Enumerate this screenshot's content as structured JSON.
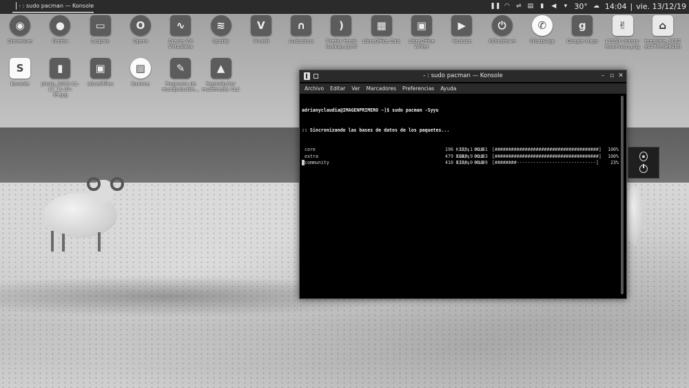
{
  "panel": {
    "task_title": "- : sudo pacman — Konsole",
    "tray": {
      "temperature": "30°",
      "clock": "14:04",
      "separator": "|",
      "date": "vie. 13/12/19",
      "icons": [
        "pause-icon",
        "wifi-icon",
        "usb-icon",
        "clipboard-icon",
        "battery-icon",
        "volume-icon",
        "expand-icon",
        "weather-cloud-icon"
      ]
    }
  },
  "desktop_icons": [
    {
      "label": "Chromium",
      "glyph": "◉",
      "icon": "chromium-icon"
    },
    {
      "label": "Firefox",
      "glyph": "●",
      "icon": "firefox-icon"
    },
    {
      "label": "Dolphin",
      "glyph": "▭",
      "icon": "folder-icon"
    },
    {
      "label": "Opera",
      "glyph": "O",
      "icon": "opera-icon"
    },
    {
      "label": "Oracle VM VirtualBox",
      "glyph": "∿",
      "icon": "virtualbox-icon"
    },
    {
      "label": "Spotify",
      "glyph": "≋",
      "icon": "spotify-icon"
    },
    {
      "label": "Vivaldi",
      "glyph": "V",
      "icon": "vivaldi-icon"
    },
    {
      "label": "Audacious",
      "glyph": "∩",
      "icon": "headphones-icon"
    },
    {
      "label": "Firefox feeds backup.opml",
      "glyph": ")",
      "icon": "rss-file-icon"
    },
    {
      "label": "LibreOffice Calc",
      "glyph": "▦",
      "icon": "calc-icon"
    },
    {
      "label": "LibreOffice Writer",
      "glyph": "▣",
      "icon": "writer-icon"
    },
    {
      "label": "Youtube",
      "glyph": "▶",
      "icon": "youtube-icon"
    },
    {
      "label": "XShutdown",
      "glyph": "⏻",
      "icon": "shutdown-icon"
    },
    {
      "label": "WhatsApp",
      "glyph": "✆",
      "icon": "whatsapp-icon"
    },
    {
      "label": "Google Maps",
      "glyph": "g",
      "icon": "google-maps-icon"
    },
    {
      "label": "11559-victory-hand-icon.png",
      "glyph": "✌",
      "icon": "victory-hand-icon"
    },
    {
      "label": "template_9682e2278ede82bb",
      "glyph": "⌂",
      "icon": "pdf-file-icon"
    },
    {
      "label": "Konsole",
      "glyph": "S",
      "icon": "konsole-icon"
    },
    {
      "label": "photo_2019-11-17_11-24-39.jpg",
      "glyph": "▮",
      "icon": "image-file-icon"
    },
    {
      "label": "LibreOffice",
      "glyph": "▣",
      "icon": "libreoffice-icon"
    },
    {
      "label": "Ramme",
      "glyph": "▨",
      "icon": "ramme-icon"
    },
    {
      "label": "Programa de manipulación...",
      "glyph": "✎",
      "icon": "gimp-icon"
    },
    {
      "label": "Reproductor multimedia VLC",
      "glyph": "▲",
      "icon": "vlc-icon"
    }
  ],
  "konsole": {
    "title": "- : sudo pacman — Konsole",
    "menu": [
      "Archivo",
      "Editar",
      "Ver",
      "Marcadores",
      "Preferencias",
      "Ayuda"
    ],
    "prompt": "adrianyclaudia@IMAGENPRIMERO ~]$ sudo pacman -Syyu",
    "sync_message": ":: Sincronizando las bases de datos de los paquetes...",
    "repos": [
      {
        "name": "core",
        "size": "135,1 KiB",
        "speed": "196 KiB/s",
        "time": "00:01",
        "bar": "[######################################]",
        "percent": "100%"
      },
      {
        "name": "extra",
        "size": "1649,9 KiB",
        "speed": "479 KiB/s",
        "time": "00:03",
        "bar": "[######################################]",
        "percent": "100%"
      },
      {
        "name": "community",
        "size": "1136,0 KiB",
        "speed": "410 KiB/s",
        "time": "00:09",
        "bar": "[########-----------------------------]",
        "percent": "23%"
      }
    ]
  }
}
